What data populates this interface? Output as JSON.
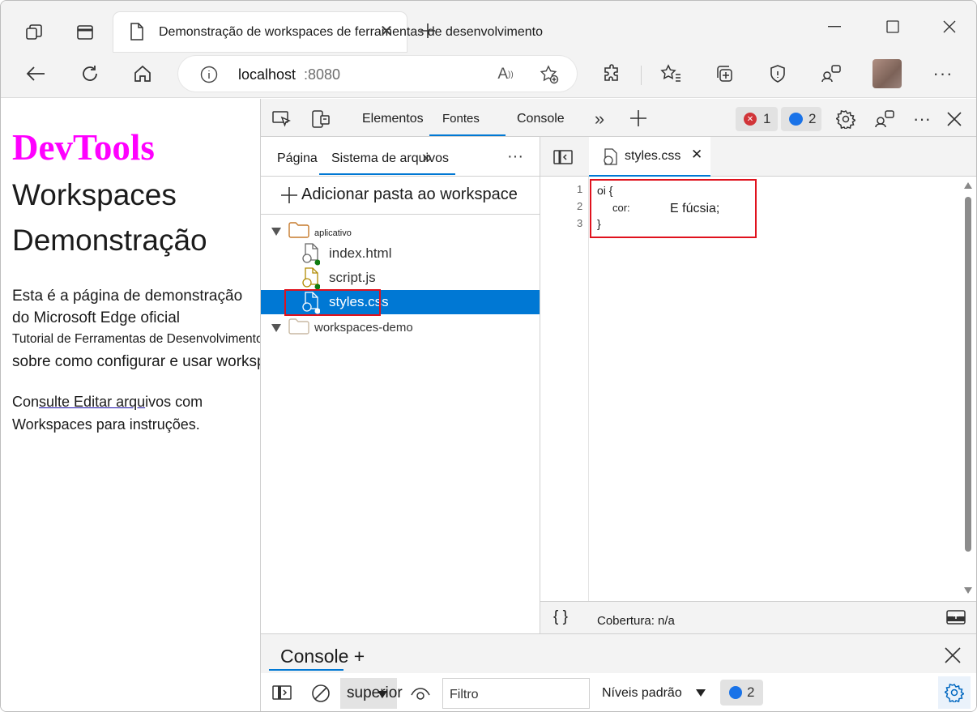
{
  "browser": {
    "tab_title": "Demonstração de workspaces de ferramentas de desenvolvimento",
    "address_host": "localhost",
    "address_port": ":8080"
  },
  "page": {
    "heading1": "DevTools",
    "heading2": "Workspaces",
    "heading3": "Demonstração",
    "para1_line1": "Esta é a página de demonstração",
    "para1_line2": "do Microsoft Edge oficial",
    "para1_line3": "Tutorial de Ferramentas de Desenvolvimento",
    "para1_line4": "sobre como configurar e usar workspaces.",
    "para2_prefix": "Con",
    "para2_link": "sulte Editar arqu",
    "para2_suffix": "ivos com",
    "para2_line2": "Workspaces para instruções.",
    "heading_color": "#ff00ff"
  },
  "devtools": {
    "tabs": [
      "Elementos",
      "Fontes",
      "Console"
    ],
    "active_tab": "Fontes",
    "error_count": "1",
    "message_count": "2",
    "sources": {
      "subtabs": [
        "Página",
        "Sistema de arquivos"
      ],
      "add_folder": "Adicionar pasta ao workspace",
      "tree": {
        "folder1": "aplicativo",
        "files": [
          "index.html",
          "script.js",
          "styles.css"
        ],
        "folder2": "workspaces-demo"
      }
    },
    "editor": {
      "file_tab": "styles.css",
      "line_numbers": [
        "1",
        "2",
        "3"
      ],
      "line1": "oi {",
      "line2_prop": "cor:",
      "line2_val": "E fúcsia;",
      "line3": "}",
      "coverage": "Cobertura: n/a",
      "format_label": "{ }"
    },
    "drawer": {
      "title": "Console +",
      "context": "superior",
      "filter_placeholder": "Filtro",
      "levels": "Níveis padrão",
      "message_count": "2"
    },
    "accent_color": "#0078d4"
  }
}
